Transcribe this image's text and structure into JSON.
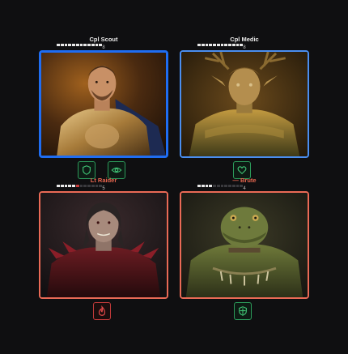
{
  "units": [
    {
      "name": "Cpl Scout",
      "level": "8",
      "team": "blue",
      "hp_fraction": 1.0,
      "selected": true,
      "status_icons": [
        "shield-icon",
        "eye-icon"
      ],
      "portrait": "armored-knight-portrait"
    },
    {
      "name": "Cpl Medic",
      "level": "8",
      "team": "blue",
      "hp_fraction": 1.0,
      "selected": false,
      "status_icons": [
        "heart-icon"
      ],
      "portrait": "elf-druid-portrait"
    },
    {
      "name": "Lt Raider",
      "level": "5",
      "team": "red",
      "hp_fraction": 0.45,
      "selected": false,
      "status_icons": [
        "flame-icon"
      ],
      "portrait": "dark-warrior-portrait"
    },
    {
      "name": "— Brute",
      "level": "4",
      "team": "red",
      "hp_fraction": 0.3,
      "selected": false,
      "status_icons": [
        "shield-cross-icon"
      ],
      "portrait": "lizard-brute-portrait"
    }
  ],
  "colors": {
    "blue_name": "#e8e8e8",
    "red_name": "#e8674f",
    "blue_border": "#4a8ef0",
    "red_border": "#ea6a56",
    "badge_green": "#2c9a5a",
    "badge_red": "#c23a3a"
  }
}
